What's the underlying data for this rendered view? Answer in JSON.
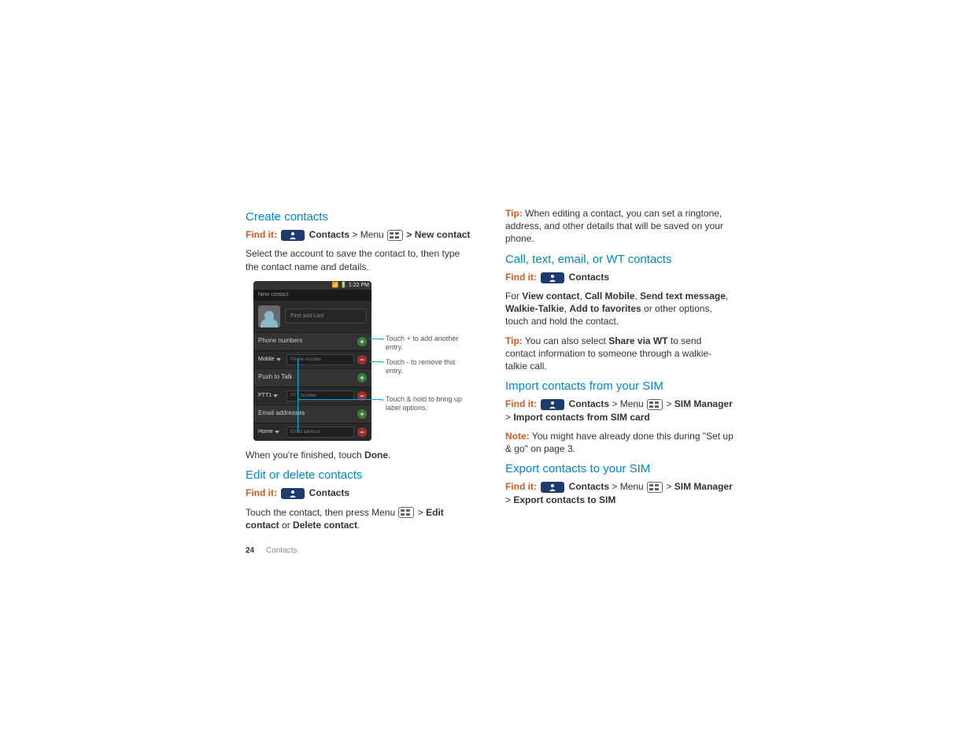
{
  "left": {
    "h_create": "Create contacts",
    "find1_prefix": "Find it:",
    "find1_contacts": "Contacts",
    "find1_menu": "> Menu",
    "find1_new": "> New contact",
    "p1": "Select the account to save the contact to, then type the contact name and details.",
    "phone": {
      "statusbar_time": "1:22 PM",
      "newcontact": "New contact",
      "first_last": "First and Last",
      "sec_phone": "Phone numbers",
      "mobile": "Mobile",
      "phone_ph": "Phone number",
      "sec_ptt": "Push to Talk",
      "ptt1": "PTT1",
      "ptt_ph": "PTT number",
      "sec_email": "Email addresses",
      "home": "Home",
      "email_ph": "Email address"
    },
    "annot_plus": "Touch + to add another entry.",
    "annot_minus": "Touch - to remove this entry.",
    "annot_hold": "Touch & hold to bring up label options.",
    "p_done_a": "When you're finished, touch ",
    "p_done_b": "Done",
    "p_done_c": ".",
    "h_edit": "Edit or delete contacts",
    "find2_prefix": "Find it:",
    "find2_contacts": "Contacts",
    "p_edit_a": "Touch the contact, then press Menu ",
    "p_edit_b": " > ",
    "p_edit_c": "Edit contact",
    "p_edit_d": " or ",
    "p_edit_e": "Delete contact",
    "p_edit_f": ".",
    "footer_page": "24",
    "footer_section": "Contacts"
  },
  "right": {
    "tip1_label": "Tip:",
    "tip1": " When editing a contact, you can set a ringtone, address, and other details that will be saved on your phone.",
    "h_call": "Call, text, email, or WT contacts",
    "find3_prefix": "Find it:",
    "find3_contacts": "Contacts",
    "p_for_a": "For ",
    "b_view": "View contact",
    "b_call": "Call Mobile",
    "b_send": "Send text message",
    "b_wt": "Walkie-Talkie",
    "b_fav": "Add to favorites",
    "p_for_b": " or other options, touch and hold the contact.",
    "tip2_label": "Tip:",
    "tip2_a": " You can also select ",
    "tip2_b": "Share via WT",
    "tip2_c": " to send contact information to someone through a walkie-talkie call.",
    "h_import": "Import contacts from your SIM",
    "find4_prefix": "Find it:",
    "find4_contacts": "Contacts",
    "find4_menu": " > Menu ",
    "find4_sim": "SIM Manager",
    "find4_gt": " > ",
    "find4_import": "Import contacts from SIM card",
    "note_label": "Note:",
    "note_text": " You might have already done this during \"Set up & go\" on page 3.",
    "h_export": "Export contacts to your SIM",
    "find5_prefix": "Find it:",
    "find5_contacts": "Contacts",
    "find5_menu": " > Menu ",
    "find5_sim": "SIM Manager",
    "find5_gt": " > ",
    "find5_export": "Export contacts to SIM"
  }
}
